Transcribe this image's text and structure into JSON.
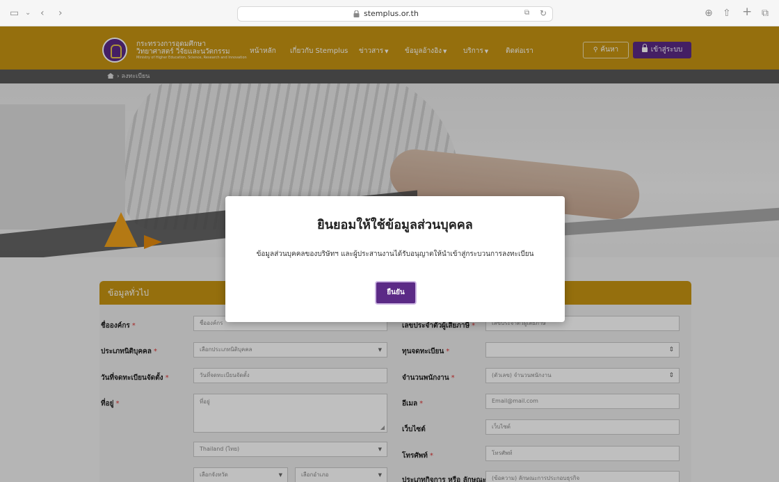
{
  "browser": {
    "url": "stemplus.or.th"
  },
  "header": {
    "ministry_line1": "กระทรวงการอุดมศึกษา",
    "ministry_line2": "วิทยาศาสตร์ วิจัยและนวัตกรรม",
    "ministry_line3": "Ministry of Higher Education, Science, Research and Innovation",
    "nav": [
      {
        "label": "หน้าหลัก"
      },
      {
        "label": "เกี่ยวกับ Stemplus"
      },
      {
        "label": "ข่าวสาร"
      },
      {
        "label": "ข้อมูลอ้างอิง"
      },
      {
        "label": "บริการ"
      },
      {
        "label": "ติดต่อเรา"
      }
    ],
    "search_label": "ค้นหา",
    "login_label": "เข้าสู่ระบบ"
  },
  "breadcrumb": {
    "current": "ลงทะเบียน"
  },
  "modal": {
    "title": "ยินยอมให้ใช้ข้อมูลส่วนบุคคล",
    "text": "ข้อมูลส่วนบุคคลของบริษัทฯ และผู้ประสานงานได้รับอนุญาตให้นำเข้าสู่กระบวนการลงทะเบียน",
    "confirm_label": "ยืนยัน"
  },
  "form": {
    "section_title": "ข้อมูลทั่วไป",
    "left": {
      "org_name_label": "ชื่อองค์กร",
      "org_name_placeholder": "ชื่อองค์กร",
      "entity_type_label": "ประเภทนิติบุคคล",
      "entity_type_value": "เลือกประเภทนิติบุคคล",
      "reg_date_label": "วันที่จดทะเบียนจัดตั้ง",
      "reg_date_placeholder": "วันที่จดทะเบียนจัดตั้ง",
      "address_label": "ที่อยู่",
      "address_placeholder": "ที่อยู่",
      "country_value": "Thailand (ไทย)",
      "province_value": "เลือกจังหวัด",
      "district_value": "เลือกอำเภอ"
    },
    "right": {
      "tax_id_label": "เลขประจำตัวผู้เสียภาษี",
      "tax_id_placeholder": "เลขประจำตัวผู้เสียภาษี",
      "capital_label": "ทุนจดทะเบียน",
      "employees_label": "จำนวนพนักงาน",
      "employees_placeholder": "(ตัวเลข) จำนวนพนักงาน",
      "email_label": "อีเมล",
      "email_placeholder": "Email@mail.com",
      "website_label": "เว็บไซต์",
      "website_placeholder": "เว็บไซต์",
      "phone_label": "โทรศัพท์",
      "phone_placeholder": "โทรศัพท์",
      "business_type_label": "ประเภทกิจการ หรือ ลักษณะ",
      "business_type_placeholder": "(ข้อความ) ลักษณะการประกอบธุรกิจ"
    }
  },
  "colors": {
    "brand_gold": "#c79512",
    "brand_purple": "#5b2a86",
    "required": "#dd3333"
  }
}
